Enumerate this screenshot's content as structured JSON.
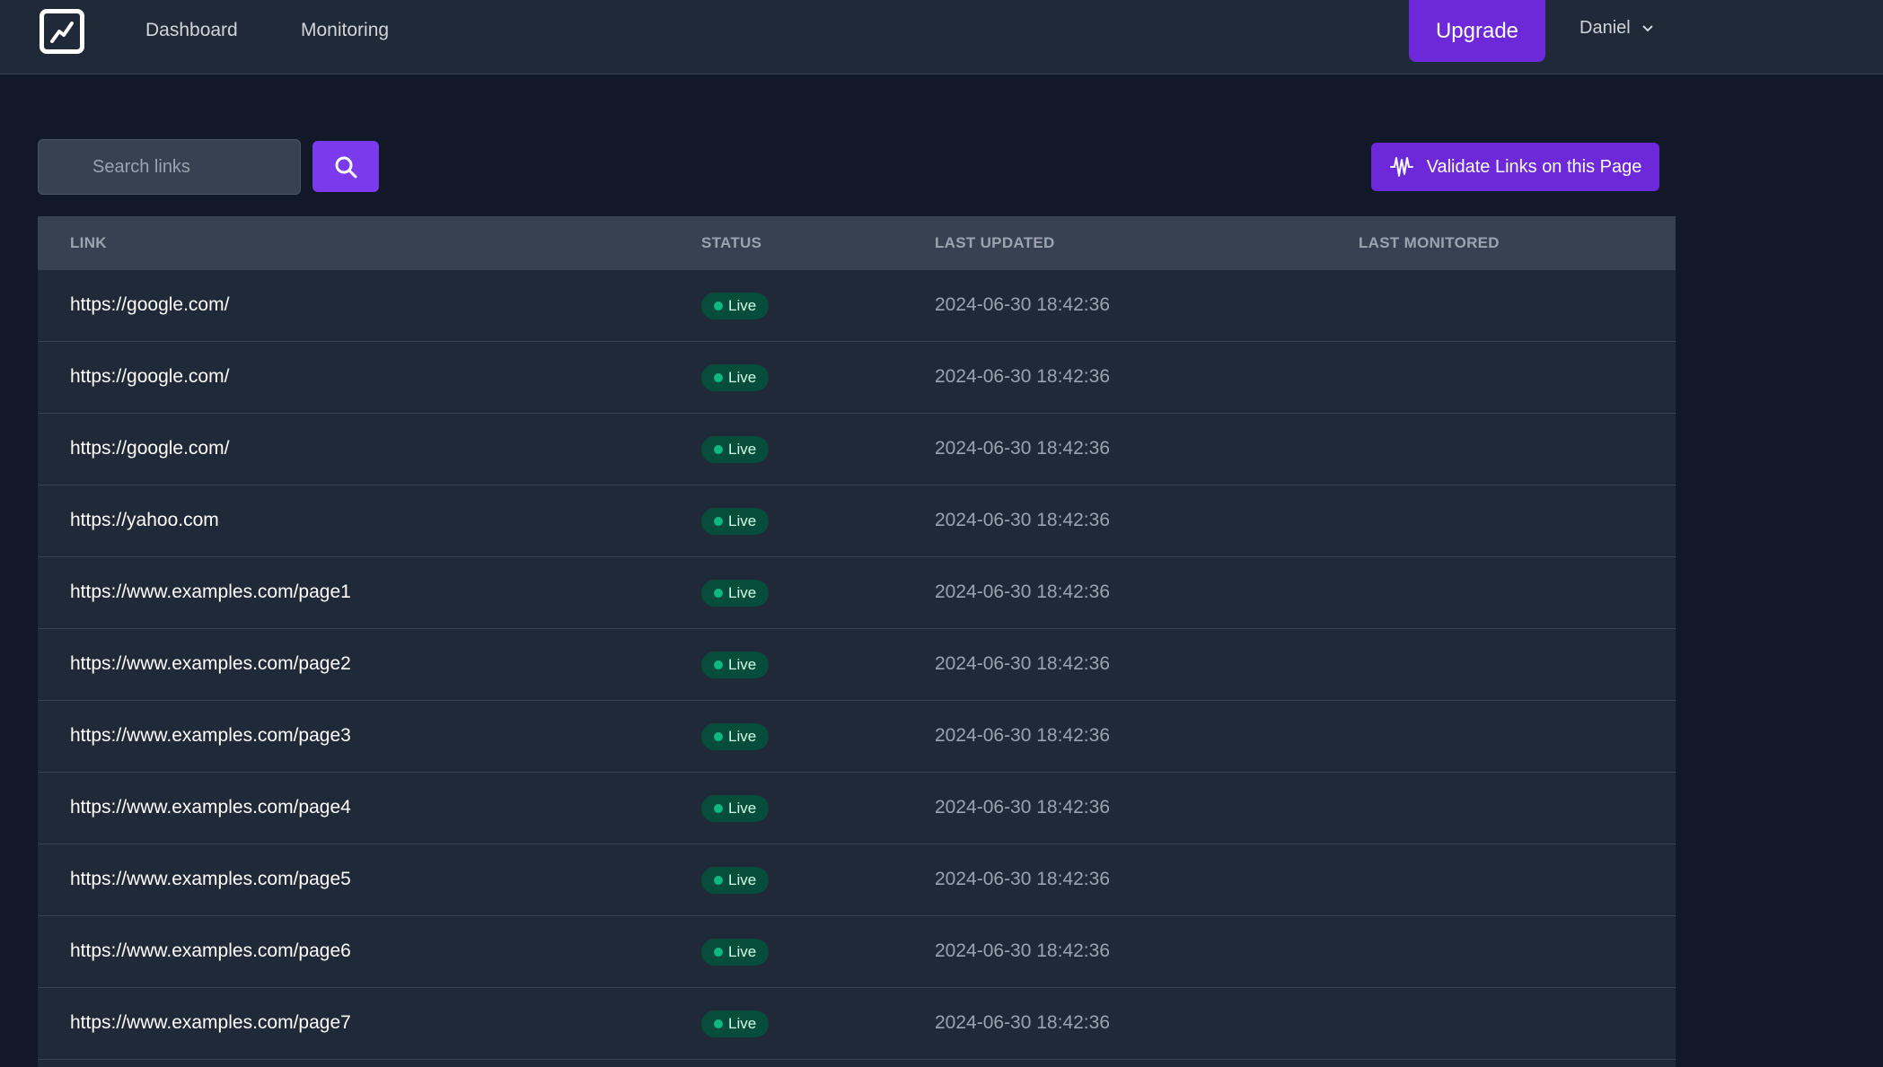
{
  "nav": {
    "logo_icon": "chart-trend-icon",
    "links": [
      "Dashboard",
      "Monitoring"
    ],
    "upgrade_label": "Upgrade",
    "user_name": "Daniel"
  },
  "toolbar": {
    "search_placeholder": "Search links",
    "search_icon": "search-icon",
    "validate_label": "Validate Links on this Page",
    "validate_icon": "waveform-icon"
  },
  "table": {
    "headers": [
      "LINK",
      "STATUS",
      "LAST UPDATED",
      "LAST MONITORED"
    ],
    "rows": [
      {
        "link": "https://google.com/",
        "status": "Live",
        "last_updated": "2024-06-30 18:42:36",
        "last_monitored": ""
      },
      {
        "link": "https://google.com/",
        "status": "Live",
        "last_updated": "2024-06-30 18:42:36",
        "last_monitored": ""
      },
      {
        "link": "https://google.com/",
        "status": "Live",
        "last_updated": "2024-06-30 18:42:36",
        "last_monitored": ""
      },
      {
        "link": "https://yahoo.com",
        "status": "Live",
        "last_updated": "2024-06-30 18:42:36",
        "last_monitored": ""
      },
      {
        "link": "https://www.examples.com/page1",
        "status": "Live",
        "last_updated": "2024-06-30 18:42:36",
        "last_monitored": ""
      },
      {
        "link": "https://www.examples.com/page2",
        "status": "Live",
        "last_updated": "2024-06-30 18:42:36",
        "last_monitored": ""
      },
      {
        "link": "https://www.examples.com/page3",
        "status": "Live",
        "last_updated": "2024-06-30 18:42:36",
        "last_monitored": ""
      },
      {
        "link": "https://www.examples.com/page4",
        "status": "Live",
        "last_updated": "2024-06-30 18:42:36",
        "last_monitored": ""
      },
      {
        "link": "https://www.examples.com/page5",
        "status": "Live",
        "last_updated": "2024-06-30 18:42:36",
        "last_monitored": ""
      },
      {
        "link": "https://www.examples.com/page6",
        "status": "Live",
        "last_updated": "2024-06-30 18:42:36",
        "last_monitored": ""
      },
      {
        "link": "https://www.examples.com/page7",
        "status": "Live",
        "last_updated": "2024-06-30 18:42:36",
        "last_monitored": ""
      }
    ]
  },
  "colors": {
    "accent": "#6d28d9",
    "background": "#111827",
    "surface": "#1f2937",
    "live_badge": "#064e3b",
    "live_dot": "#10b981"
  }
}
